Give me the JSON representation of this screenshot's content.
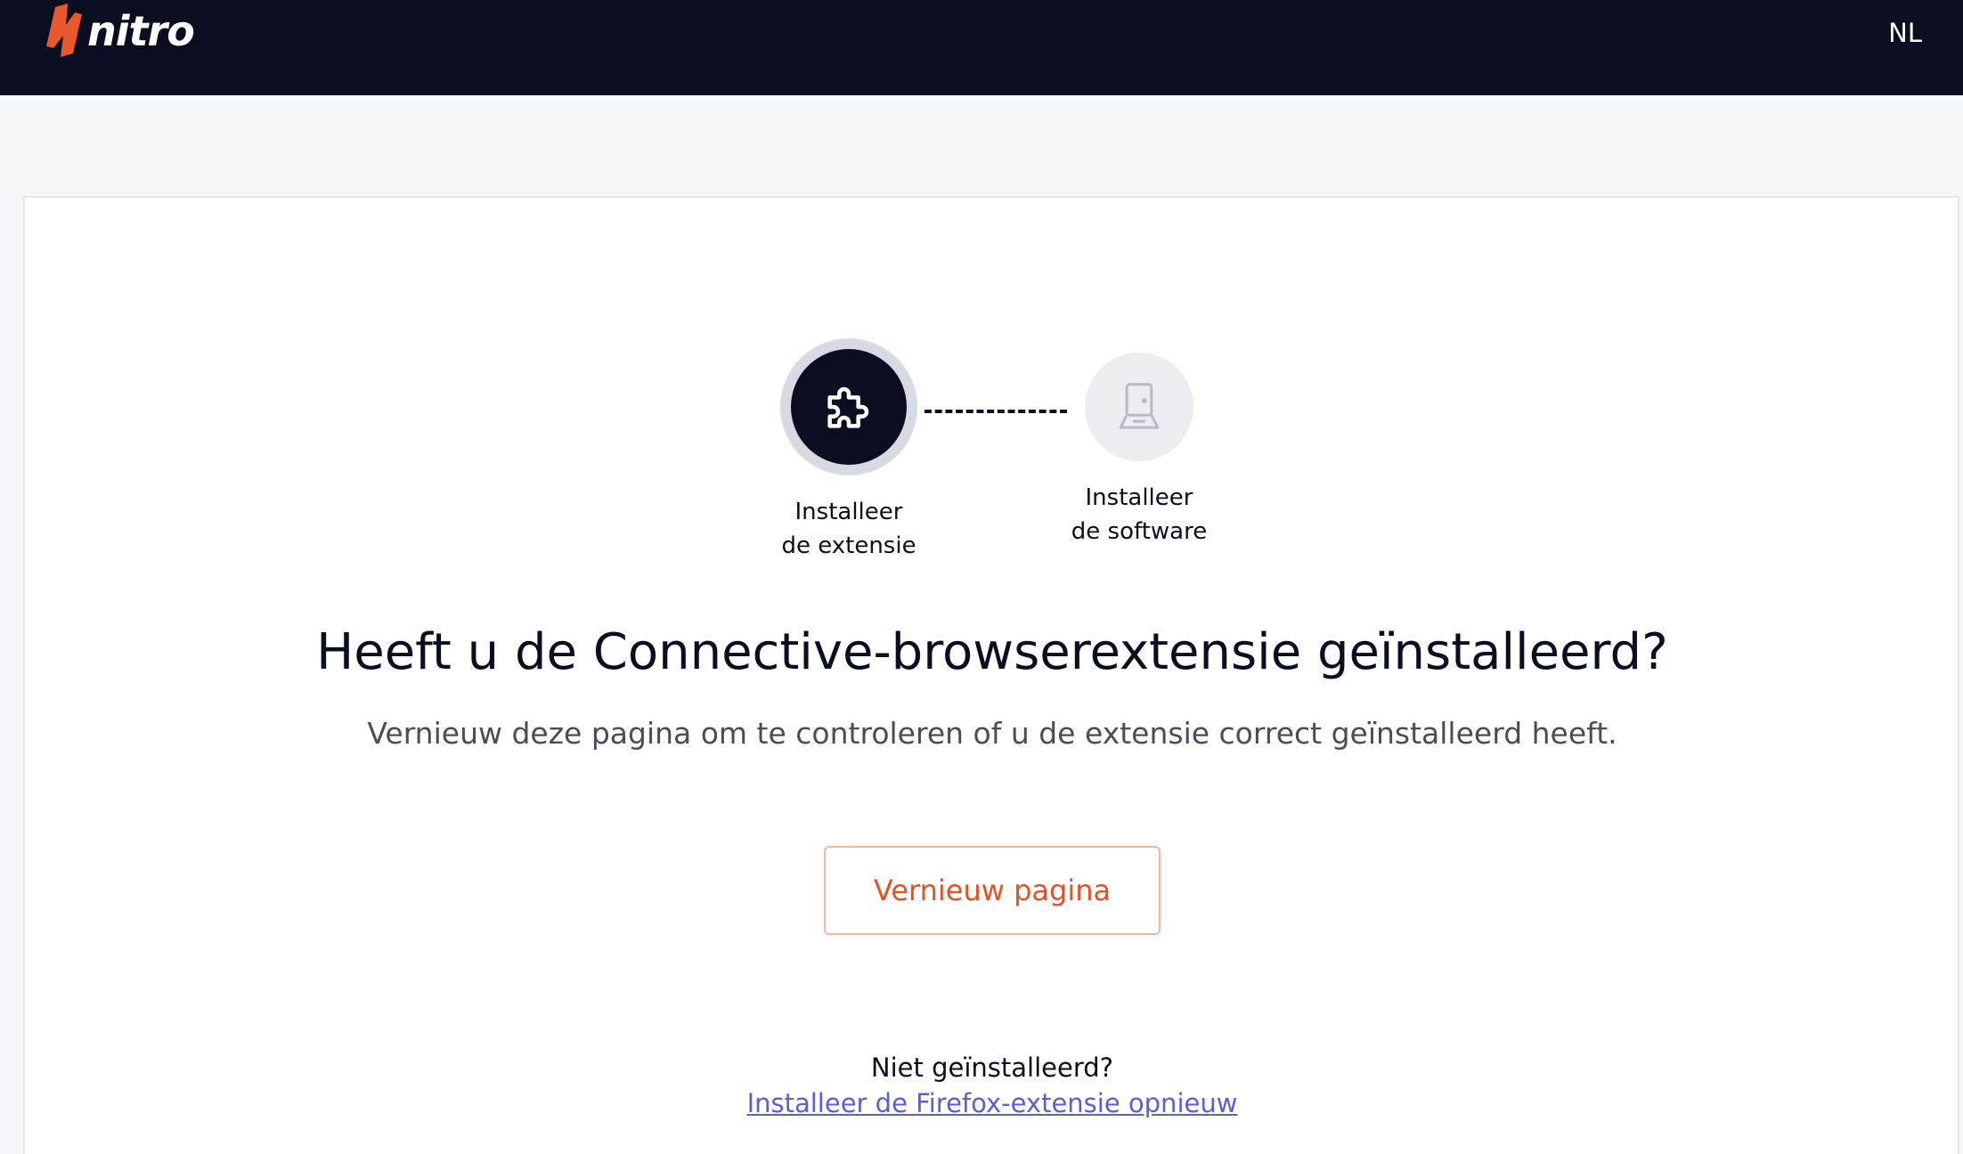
{
  "header": {
    "logo_text": "nitro",
    "language": "NL",
    "brand_color": "#e8582c",
    "bar_color": "#0b0d21"
  },
  "steps": [
    {
      "label_line1": "Installeer",
      "label_line2": "de extensie",
      "icon": "puzzle-icon",
      "state": "active"
    },
    {
      "label_line1": "Installeer",
      "label_line2": "de software",
      "icon": "computer-icon",
      "state": "inactive"
    }
  ],
  "main": {
    "heading": "Heeft u de Connective-browserextensie geïnstalleerd?",
    "subheading": "Vernieuw deze pagina om te controleren of u de extensie correct geïnstalleerd heeft.",
    "refresh_button": "Vernieuw pagina",
    "not_installed_text": "Niet geïnstalleerd?",
    "reinstall_link": "Installeer de Firefox-extensie opnieuw"
  },
  "colors": {
    "accent": "#e0522a",
    "link": "#5a5fd6",
    "page_bg": "#f5f6f9"
  }
}
